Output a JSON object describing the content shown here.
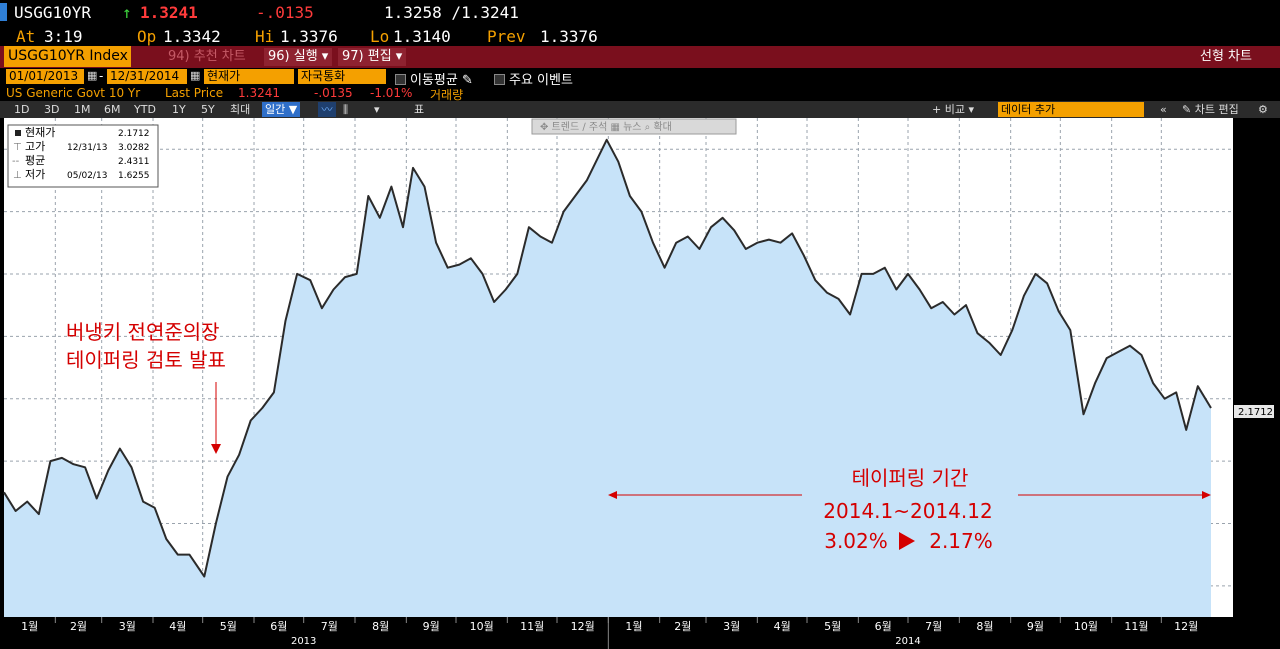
{
  "header": {
    "ticker": "USGG10YR",
    "arrow": "↑",
    "last": "1.3241",
    "change": "-.0135",
    "bid_ask": "1.3258 /1.3241",
    "at_label": "At",
    "at_value": "3:19",
    "op_label": "Op",
    "op_value": "1.3342",
    "hi_label": "Hi",
    "hi_value": "1.3376",
    "lo_label": "Lo",
    "lo_value": "1.3140",
    "prev_label": "Prev",
    "prev_value": "1.3376"
  },
  "menubar": {
    "index": "USGG10YR Index",
    "item1": "94) 추천 차트",
    "item2": "96) 실행 ▾",
    "item3": "97) 편집 ▾",
    "right": "선형 차트"
  },
  "settings": {
    "start_date": "01/01/2013",
    "end_date": "12/31/2014",
    "price_field": "현재가",
    "currency": "자국통화",
    "moving_avg": "이동평균",
    "events": "주요 이벤트"
  },
  "security": {
    "name": "US Generic Govt 10 Yr",
    "last_label": "Last Price",
    "last_value": "1.3241",
    "chg": "-.0135",
    "pct": "-1.01%",
    "volume": "거래량"
  },
  "toolbar": {
    "periods": [
      "1D",
      "3D",
      "1M",
      "6M",
      "YTD",
      "1Y",
      "5Y",
      "최대"
    ],
    "frequency": "일간 ▼",
    "table": "표",
    "compare": "+ 비교 ▾",
    "add_data": "데이터 추가",
    "edit_chart": "차트 편집"
  },
  "chart_tools": "✥ 트렌드   ∕ 주석   ▦ 뉴스   ⌕ 확대",
  "legend": {
    "current_label": "현재가",
    "current_value": "2.1712",
    "high_label": "고가",
    "high_date": "12/31/13",
    "high_value": "3.0282",
    "avg_label": "평균",
    "avg_value": "2.4311",
    "low_label": "저가",
    "low_date": "05/02/13",
    "low_value": "1.6255"
  },
  "annotations": {
    "bernanke_line1": "버냉키 전연준의장",
    "bernanke_line2": "테이퍼링 검토 발표",
    "taper_title": "테이퍼링 기간",
    "taper_range": "2014.1~2014.12",
    "taper_from": "3.02%",
    "taper_to": "2.17%"
  },
  "colors": {
    "line": "#2b2b2b",
    "fill": "#c7e3f9",
    "annotation": "#d40000",
    "accent": "#f4a000",
    "menubar": "#7a0f1d"
  },
  "chart_data": {
    "type": "area",
    "ylim": [
      1.5,
      3.1
    ],
    "yticks": [
      "1.6000",
      "1.8000",
      "2.0000",
      "2.2000",
      "2.4000",
      "2.6000",
      "2.8000",
      "3.0000"
    ],
    "last_value_label": "2.1712",
    "month_labels": [
      "1월",
      "2월",
      "3월",
      "4월",
      "5월",
      "6월",
      "7월",
      "8월",
      "9월",
      "10월",
      "11월",
      "12월",
      "1월",
      "2월",
      "3월",
      "4월",
      "5월",
      "6월",
      "7월",
      "8월",
      "9월",
      "10월",
      "11월",
      "12월"
    ],
    "year_labels": [
      "2013",
      "2014"
    ],
    "x": [
      "2013-01-01",
      "2013-01-08",
      "2013-01-15",
      "2013-01-22",
      "2013-01-29",
      "2013-02-05",
      "2013-02-12",
      "2013-02-19",
      "2013-02-26",
      "2013-03-05",
      "2013-03-12",
      "2013-03-19",
      "2013-03-26",
      "2013-04-02",
      "2013-04-09",
      "2013-04-16",
      "2013-04-23",
      "2013-05-02",
      "2013-05-09",
      "2013-05-16",
      "2013-05-23",
      "2013-05-30",
      "2013-06-06",
      "2013-06-13",
      "2013-06-20",
      "2013-06-27",
      "2013-07-05",
      "2013-07-12",
      "2013-07-19",
      "2013-07-26",
      "2013-08-02",
      "2013-08-09",
      "2013-08-16",
      "2013-08-23",
      "2013-08-30",
      "2013-09-05",
      "2013-09-12",
      "2013-09-19",
      "2013-09-26",
      "2013-10-03",
      "2013-10-10",
      "2013-10-17",
      "2013-10-24",
      "2013-10-31",
      "2013-11-07",
      "2013-11-14",
      "2013-11-21",
      "2013-11-28",
      "2013-12-05",
      "2013-12-12",
      "2013-12-19",
      "2013-12-31",
      "2014-01-07",
      "2014-01-14",
      "2014-01-21",
      "2014-01-28",
      "2014-02-04",
      "2014-02-11",
      "2014-02-18",
      "2014-02-25",
      "2014-03-04",
      "2014-03-11",
      "2014-03-18",
      "2014-03-25",
      "2014-04-01",
      "2014-04-08",
      "2014-04-15",
      "2014-04-22",
      "2014-04-29",
      "2014-05-06",
      "2014-05-13",
      "2014-05-20",
      "2014-05-27",
      "2014-06-03",
      "2014-06-10",
      "2014-06-17",
      "2014-06-24",
      "2014-07-01",
      "2014-07-08",
      "2014-07-15",
      "2014-07-22",
      "2014-07-29",
      "2014-08-05",
      "2014-08-12",
      "2014-08-19",
      "2014-08-26",
      "2014-09-02",
      "2014-09-09",
      "2014-09-16",
      "2014-09-23",
      "2014-09-30",
      "2014-10-07",
      "2014-10-15",
      "2014-10-22",
      "2014-10-29",
      "2014-11-05",
      "2014-11-12",
      "2014-11-19",
      "2014-11-26",
      "2014-12-03",
      "2014-12-10",
      "2014-12-16",
      "2014-12-23",
      "2014-12-31"
    ],
    "values": [
      1.9,
      1.84,
      1.87,
      1.83,
      2.0,
      2.01,
      1.99,
      1.98,
      1.88,
      1.97,
      2.04,
      1.98,
      1.87,
      1.85,
      1.75,
      1.7,
      1.7,
      1.63,
      1.8,
      1.95,
      2.02,
      2.13,
      2.17,
      2.22,
      2.45,
      2.6,
      2.58,
      2.49,
      2.55,
      2.59,
      2.6,
      2.85,
      2.78,
      2.88,
      2.75,
      2.94,
      2.88,
      2.7,
      2.62,
      2.63,
      2.65,
      2.6,
      2.51,
      2.55,
      2.6,
      2.75,
      2.72,
      2.7,
      2.8,
      2.85,
      2.9,
      3.03,
      2.96,
      2.85,
      2.8,
      2.7,
      2.62,
      2.7,
      2.72,
      2.68,
      2.75,
      2.78,
      2.74,
      2.68,
      2.7,
      2.71,
      2.7,
      2.73,
      2.66,
      2.58,
      2.54,
      2.52,
      2.47,
      2.6,
      2.6,
      2.62,
      2.55,
      2.6,
      2.55,
      2.49,
      2.51,
      2.47,
      2.5,
      2.41,
      2.38,
      2.34,
      2.42,
      2.53,
      2.6,
      2.57,
      2.48,
      2.42,
      2.15,
      2.25,
      2.33,
      2.35,
      2.37,
      2.34,
      2.25,
      2.2,
      2.22,
      2.1,
      2.24,
      2.17
    ]
  }
}
